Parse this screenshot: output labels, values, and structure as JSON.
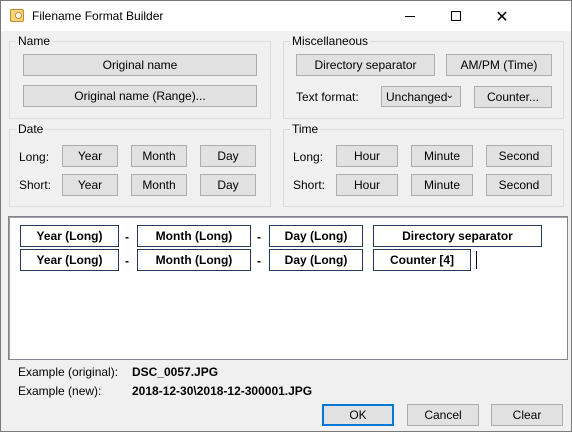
{
  "window": {
    "title": "Filename Format Builder",
    "icons": {
      "app": "app-picture-icon",
      "minimize": "minimize-icon",
      "maximize": "maximize-icon",
      "close": "close-icon"
    },
    "close_glyph": "✕"
  },
  "name_group": {
    "label": "Name",
    "original_name": "Original name",
    "original_name_range": "Original name (Range)..."
  },
  "misc_group": {
    "label": "Miscellaneous",
    "directory_separator": "Directory separator",
    "ampm": "AM/PM (Time)",
    "text_format_label": "Text format:",
    "text_format_value": "Unchanged",
    "counter": "Counter..."
  },
  "date_group": {
    "label": "Date",
    "long_label": "Long:",
    "short_label": "Short:",
    "year": "Year",
    "month": "Month",
    "day": "Day"
  },
  "time_group": {
    "label": "Time",
    "long_label": "Long:",
    "short_label": "Short:",
    "hour": "Hour",
    "minute": "Minute",
    "second": "Second"
  },
  "editor": {
    "line1": [
      "Year (Long)",
      "Month (Long)",
      "Day (Long)",
      "Directory separator"
    ],
    "line2": [
      "Year (Long)",
      "Month (Long)",
      "Day (Long)",
      "Counter [4]"
    ],
    "separator": "-"
  },
  "examples": {
    "original_label": "Example (original):",
    "original_value": "DSC_0057.JPG",
    "new_label": "Example (new):",
    "new_value": "2018-12-30\\2018-12-300001.JPG"
  },
  "footer": {
    "ok": "OK",
    "cancel": "Cancel",
    "clear": "Clear"
  },
  "colors": {
    "dialog_bg": "#f0f0f0",
    "button_face": "#e1e1e1",
    "button_border": "#adadad",
    "default_button_border": "#0078d7",
    "token_border": "#1f3c5a"
  }
}
